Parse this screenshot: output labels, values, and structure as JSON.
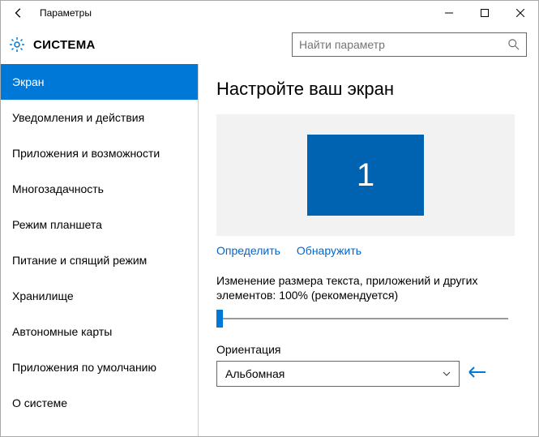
{
  "window": {
    "title": "Параметры"
  },
  "header": {
    "section": "СИСТЕМА",
    "search_placeholder": "Найти параметр"
  },
  "sidebar": {
    "items": [
      {
        "label": "Экран",
        "selected": true
      },
      {
        "label": "Уведомления и действия"
      },
      {
        "label": "Приложения и возможности"
      },
      {
        "label": "Многозадачность"
      },
      {
        "label": "Режим планшета"
      },
      {
        "label": "Питание и спящий режим"
      },
      {
        "label": "Хранилище"
      },
      {
        "label": "Автономные карты"
      },
      {
        "label": "Приложения по умолчанию"
      },
      {
        "label": "О системе"
      }
    ]
  },
  "main": {
    "heading": "Настройте ваш экран",
    "monitor_number": "1",
    "link_identify": "Определить",
    "link_detect": "Обнаружить",
    "scale_text": "Изменение размера текста, приложений и других элементов: 100% (рекомендуется)",
    "orientation_label": "Ориентация",
    "orientation_value": "Альбомная"
  }
}
